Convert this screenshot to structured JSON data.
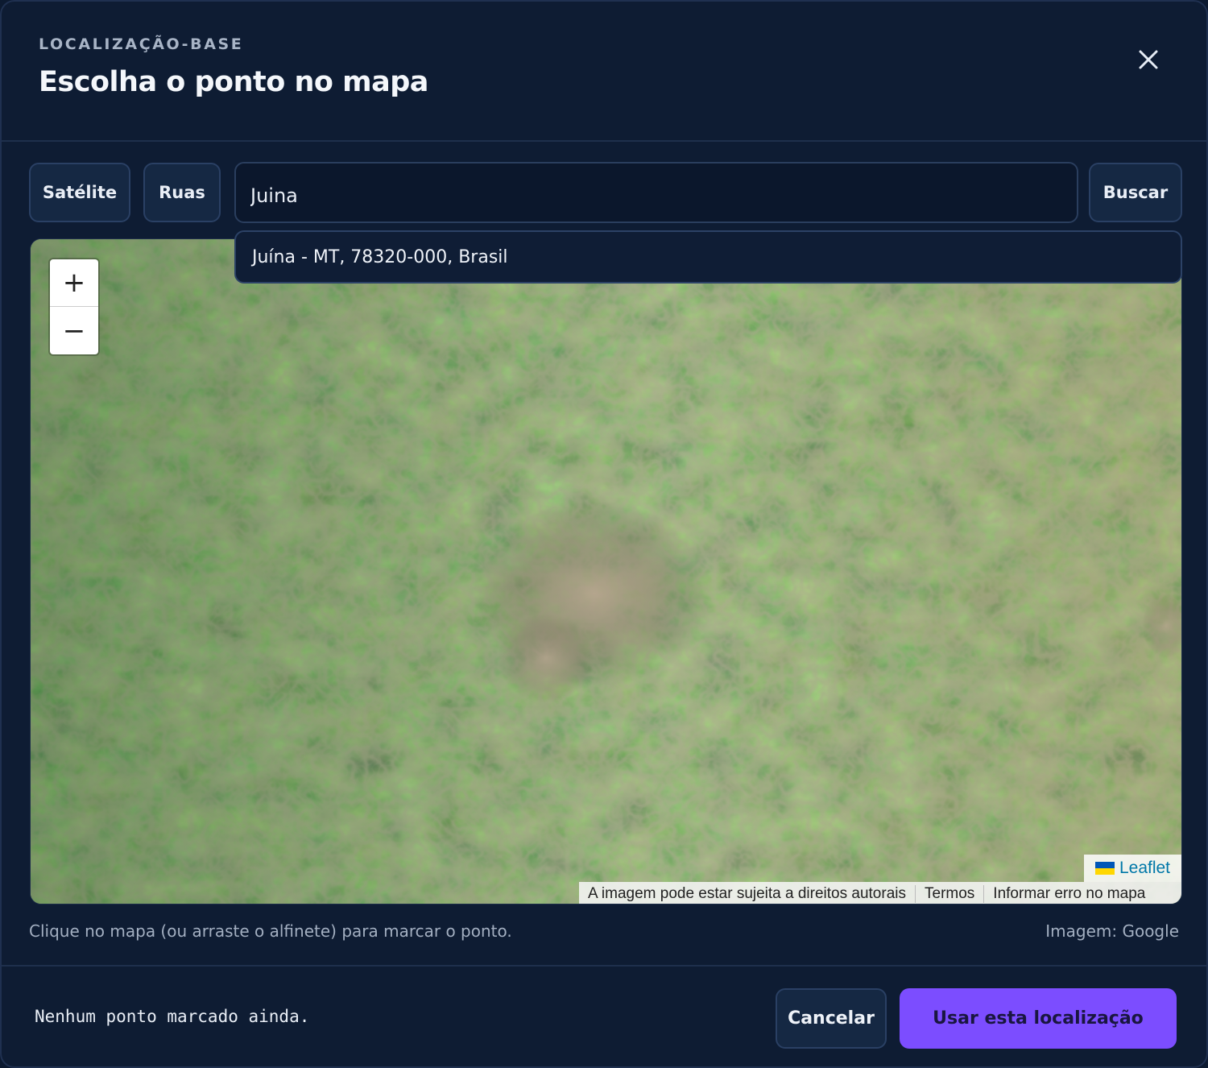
{
  "header": {
    "eyebrow": "LOCALIZAÇÃO-BASE",
    "title": "Escolha o ponto no mapa"
  },
  "toolbar": {
    "satellite_label": "Satélite",
    "streets_label": "Ruas",
    "search_value": "Juina",
    "search_button_label": "Buscar"
  },
  "suggestion": {
    "text": "Juína - MT, 78320-000, Brasil"
  },
  "map": {
    "zoom_in_label": "+",
    "zoom_out_label": "−",
    "leaflet_label": "Leaflet",
    "attribution": {
      "copyright": "A imagem pode estar sujeita a direitos autorais",
      "terms": "Termos",
      "report": "Informar erro no mapa"
    }
  },
  "hint": "Clique no mapa (ou arraste o alfinete) para marcar o ponto.",
  "credit": "Imagem: Google",
  "footer": {
    "status": "Nenhum ponto marcado ainda.",
    "cancel_label": "Cancelar",
    "confirm_label": "Usar esta localização"
  },
  "colors": {
    "accent": "#7c4dff",
    "background": "#0e1c33",
    "button_bg": "#152843"
  },
  "icons": {
    "close": "close-icon",
    "leaflet_flag": "ukraine-flag-icon"
  }
}
